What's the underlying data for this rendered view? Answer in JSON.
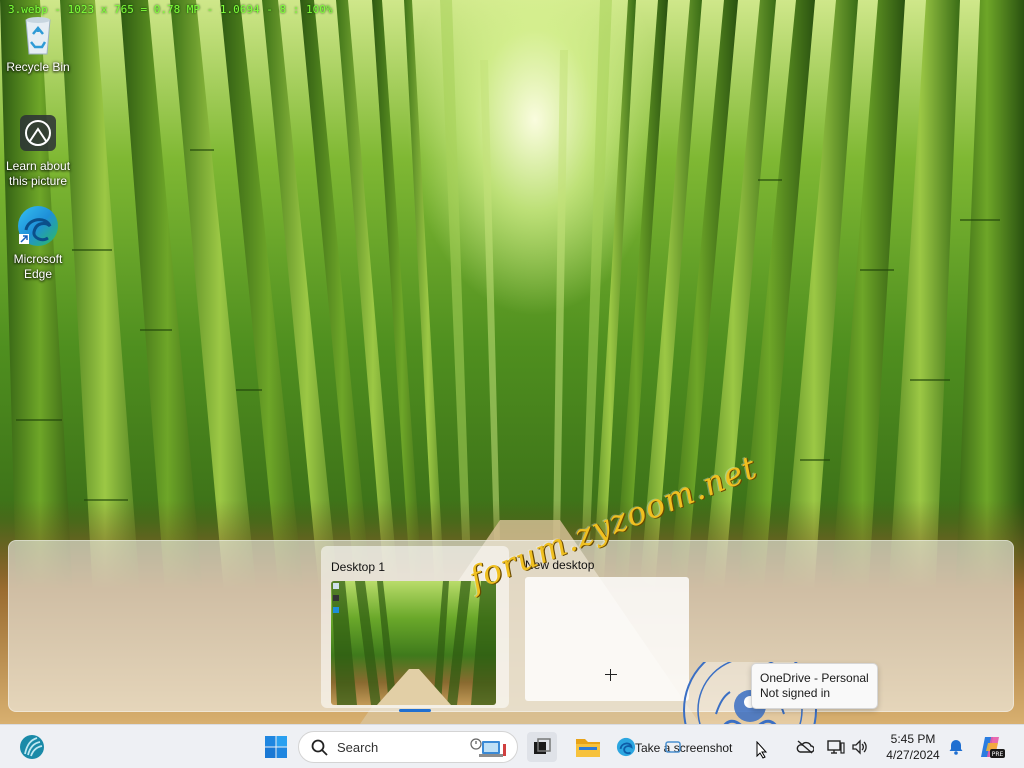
{
  "overlay": {
    "info": "3.webp - 1023 x 765 = 0.78 MP - 1.0694 - 8 : 100%"
  },
  "desktop_icons": [
    {
      "name": "recycle-bin",
      "label": "Recycle Bin"
    },
    {
      "name": "learn-about-picture",
      "label": "Learn about this picture"
    },
    {
      "name": "microsoft-edge",
      "label": "Microsoft Edge"
    }
  ],
  "task_view": {
    "desktops": [
      {
        "title": "Desktop 1",
        "current": true
      },
      {
        "title": "New desktop",
        "current": false
      }
    ]
  },
  "watermark": {
    "text": "forum.zyzoom.net"
  },
  "tooltip": {
    "title": "OneDrive - Personal",
    "status": "Not signed in"
  },
  "taskbar": {
    "search_placeholder": "Search",
    "snipping_label": "Take a screenshot",
    "time": "5:45 PM",
    "date": "4/27/2024",
    "icons": [
      "widgets-icon",
      "start-icon",
      "search-icon",
      "task-view-icon",
      "file-explorer-icon",
      "edge-icon",
      "snipping-tool-icon",
      "onedrive-icon",
      "network-icon",
      "volume-icon",
      "notifications-icon",
      "copilot-icon"
    ]
  },
  "colors": {
    "accent": "#1f6fd1",
    "watermark": "#f0c020",
    "overlay_text": "#7fff3a"
  }
}
